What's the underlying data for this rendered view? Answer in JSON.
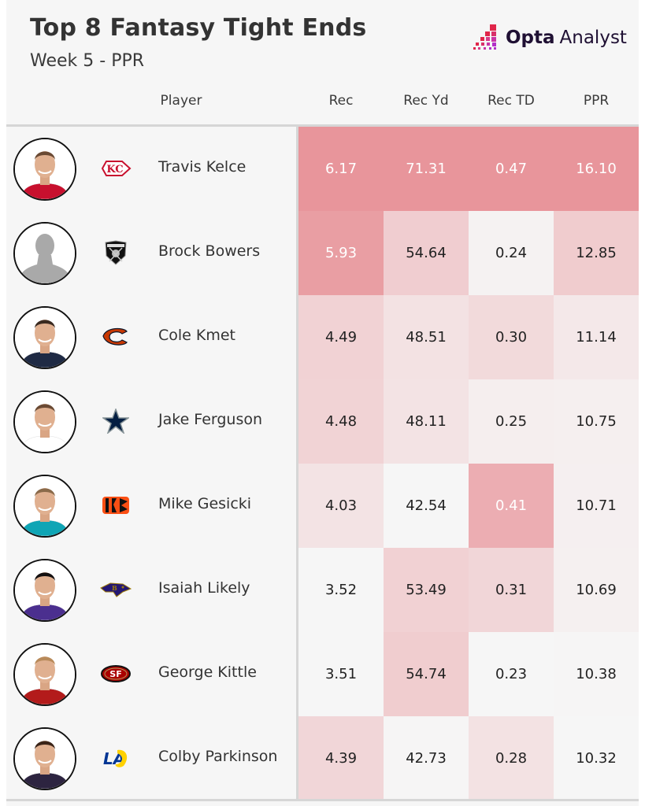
{
  "header": {
    "title": "Top 8 Fantasy Tight Ends",
    "subtitle": "Week 5 - PPR",
    "brand_bold": "Opta",
    "brand_light": "Analyst"
  },
  "columns": [
    "Player",
    "Rec",
    "Rec Yd",
    "Rec TD",
    "PPR"
  ],
  "colors": {
    "background": "#f6f6f6",
    "heat_low": "#f6f6f6",
    "heat_high": "#e8959b",
    "text_dark": "#222222",
    "text_light": "#ffffff",
    "brand_red": "#e0264a",
    "brand_purple": "#b330c8"
  },
  "rows": [
    {
      "player": "Travis Kelce",
      "team": "Kansas City Chiefs",
      "team_icon": "chiefs-arrowhead-icon",
      "avatar": "player-photo",
      "rec": "6.17",
      "rec_yd": "71.31",
      "rec_td": "0.47",
      "ppr": "16.10"
    },
    {
      "player": "Brock Bowers",
      "team": "Las Vegas Raiders",
      "team_icon": "raiders-shield-icon",
      "avatar": "placeholder-silhouette",
      "rec": "5.93",
      "rec_yd": "54.64",
      "rec_td": "0.24",
      "ppr": "12.85"
    },
    {
      "player": "Cole Kmet",
      "team": "Chicago Bears",
      "team_icon": "bears-c-icon",
      "avatar": "player-photo",
      "rec": "4.49",
      "rec_yd": "48.51",
      "rec_td": "0.30",
      "ppr": "11.14"
    },
    {
      "player": "Jake Ferguson",
      "team": "Dallas Cowboys",
      "team_icon": "cowboys-star-icon",
      "avatar": "player-photo",
      "rec": "4.48",
      "rec_yd": "48.11",
      "rec_td": "0.25",
      "ppr": "10.75"
    },
    {
      "player": "Mike Gesicki",
      "team": "Cincinnati Bengals",
      "team_icon": "bengals-b-icon",
      "avatar": "player-photo",
      "rec": "4.03",
      "rec_yd": "42.54",
      "rec_td": "0.41",
      "ppr": "10.71"
    },
    {
      "player": "Isaiah Likely",
      "team": "Baltimore Ravens",
      "team_icon": "ravens-head-icon",
      "avatar": "player-photo",
      "rec": "3.52",
      "rec_yd": "53.49",
      "rec_td": "0.31",
      "ppr": "10.69"
    },
    {
      "player": "George Kittle",
      "team": "San Francisco 49ers",
      "team_icon": "49ers-oval-icon",
      "avatar": "player-photo",
      "rec": "3.51",
      "rec_yd": "54.74",
      "rec_td": "0.23",
      "ppr": "10.38"
    },
    {
      "player": "Colby Parkinson",
      "team": "Los Angeles Rams",
      "team_icon": "rams-la-icon",
      "avatar": "player-photo",
      "rec": "4.39",
      "rec_yd": "42.73",
      "rec_td": "0.28",
      "ppr": "10.32"
    }
  ],
  "chart_data": {
    "type": "table",
    "title": "Top 8 Fantasy Tight Ends",
    "subtitle": "Week 5 - PPR",
    "columns": [
      "Player",
      "Rec",
      "Rec Yd",
      "Rec TD",
      "PPR"
    ],
    "categories": [
      "Travis Kelce",
      "Brock Bowers",
      "Cole Kmet",
      "Jake Ferguson",
      "Mike Gesicki",
      "Isaiah Likely",
      "George Kittle",
      "Colby Parkinson"
    ],
    "series": [
      {
        "name": "Rec",
        "values": [
          6.17,
          5.93,
          4.49,
          4.48,
          4.03,
          3.52,
          3.51,
          4.39
        ]
      },
      {
        "name": "Rec Yd",
        "values": [
          71.31,
          54.64,
          48.51,
          48.11,
          42.54,
          53.49,
          54.74,
          42.73
        ]
      },
      {
        "name": "Rec TD",
        "values": [
          0.47,
          0.24,
          0.3,
          0.25,
          0.41,
          0.31,
          0.23,
          0.28
        ]
      },
      {
        "name": "PPR",
        "values": [
          16.1,
          12.85,
          11.14,
          10.75,
          10.71,
          10.69,
          10.38,
          10.32
        ]
      }
    ],
    "color_scale": "per-column heatmap, light grey (min) to pink-red (max)"
  }
}
